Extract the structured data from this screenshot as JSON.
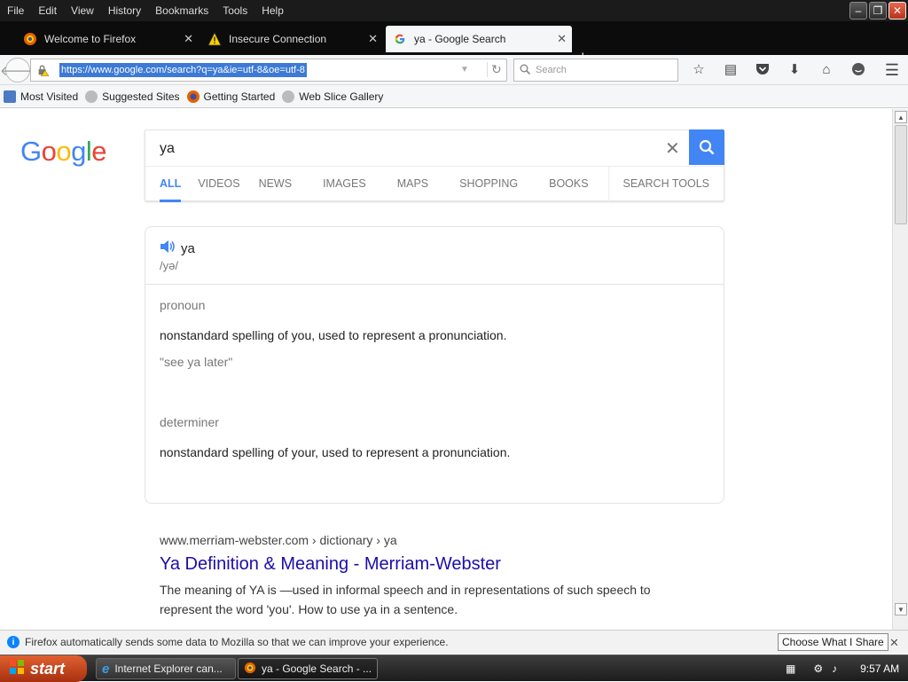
{
  "menubar": {
    "items": [
      "File",
      "Edit",
      "View",
      "History",
      "Bookmarks",
      "Tools",
      "Help"
    ]
  },
  "tabs": [
    {
      "title": "Welcome to Firefox",
      "icon": "firefox-icon"
    },
    {
      "title": "Insecure Connection",
      "icon": "warning-icon"
    },
    {
      "title": "ya - Google Search",
      "icon": "google-g-icon",
      "active": true
    }
  ],
  "navbar": {
    "url": "https://www.google.com/search?q=ya&ie=utf-8&oe=utf-8",
    "search_placeholder": "Search"
  },
  "bookmarks": [
    "Most Visited",
    "Suggested Sites",
    "Getting Started",
    "Web Slice Gallery"
  ],
  "google": {
    "query": "ya",
    "tabs": [
      "ALL",
      "VIDEOS",
      "NEWS",
      "IMAGES",
      "MAPS",
      "SHOPPING",
      "BOOKS"
    ],
    "search_tools": "SEARCH TOOLS"
  },
  "dictionary": {
    "word": "ya",
    "phonetic": "/yə/",
    "entries": [
      {
        "pos": "pronoun",
        "definition": "nonstandard spelling of you, used to represent a pronunciation.",
        "example": "\"see ya later\""
      },
      {
        "pos": "determiner",
        "definition": "nonstandard spelling of your, used to represent a pronunciation."
      }
    ]
  },
  "result": {
    "cite": "www.merriam-webster.com › dictionary › ya",
    "title": "Ya Definition & Meaning - Merriam-Webster",
    "snippet": "The meaning of YA is —used in informal speech and in representations of such speech to represent the word 'you'. How to use ya in a sentence."
  },
  "notification": {
    "message": "Firefox automatically sends some data to Mozilla so that we can improve your experience.",
    "button": "Choose What I Share"
  },
  "taskbar": {
    "start": "start",
    "tasks": [
      "Internet Explorer can...",
      "ya - Google Search - ..."
    ],
    "clock": "9:57 AM"
  },
  "colors": {
    "google_blue": "#4285f4",
    "link": "#1a0dab",
    "url_highlight": "#3d7ad6"
  }
}
